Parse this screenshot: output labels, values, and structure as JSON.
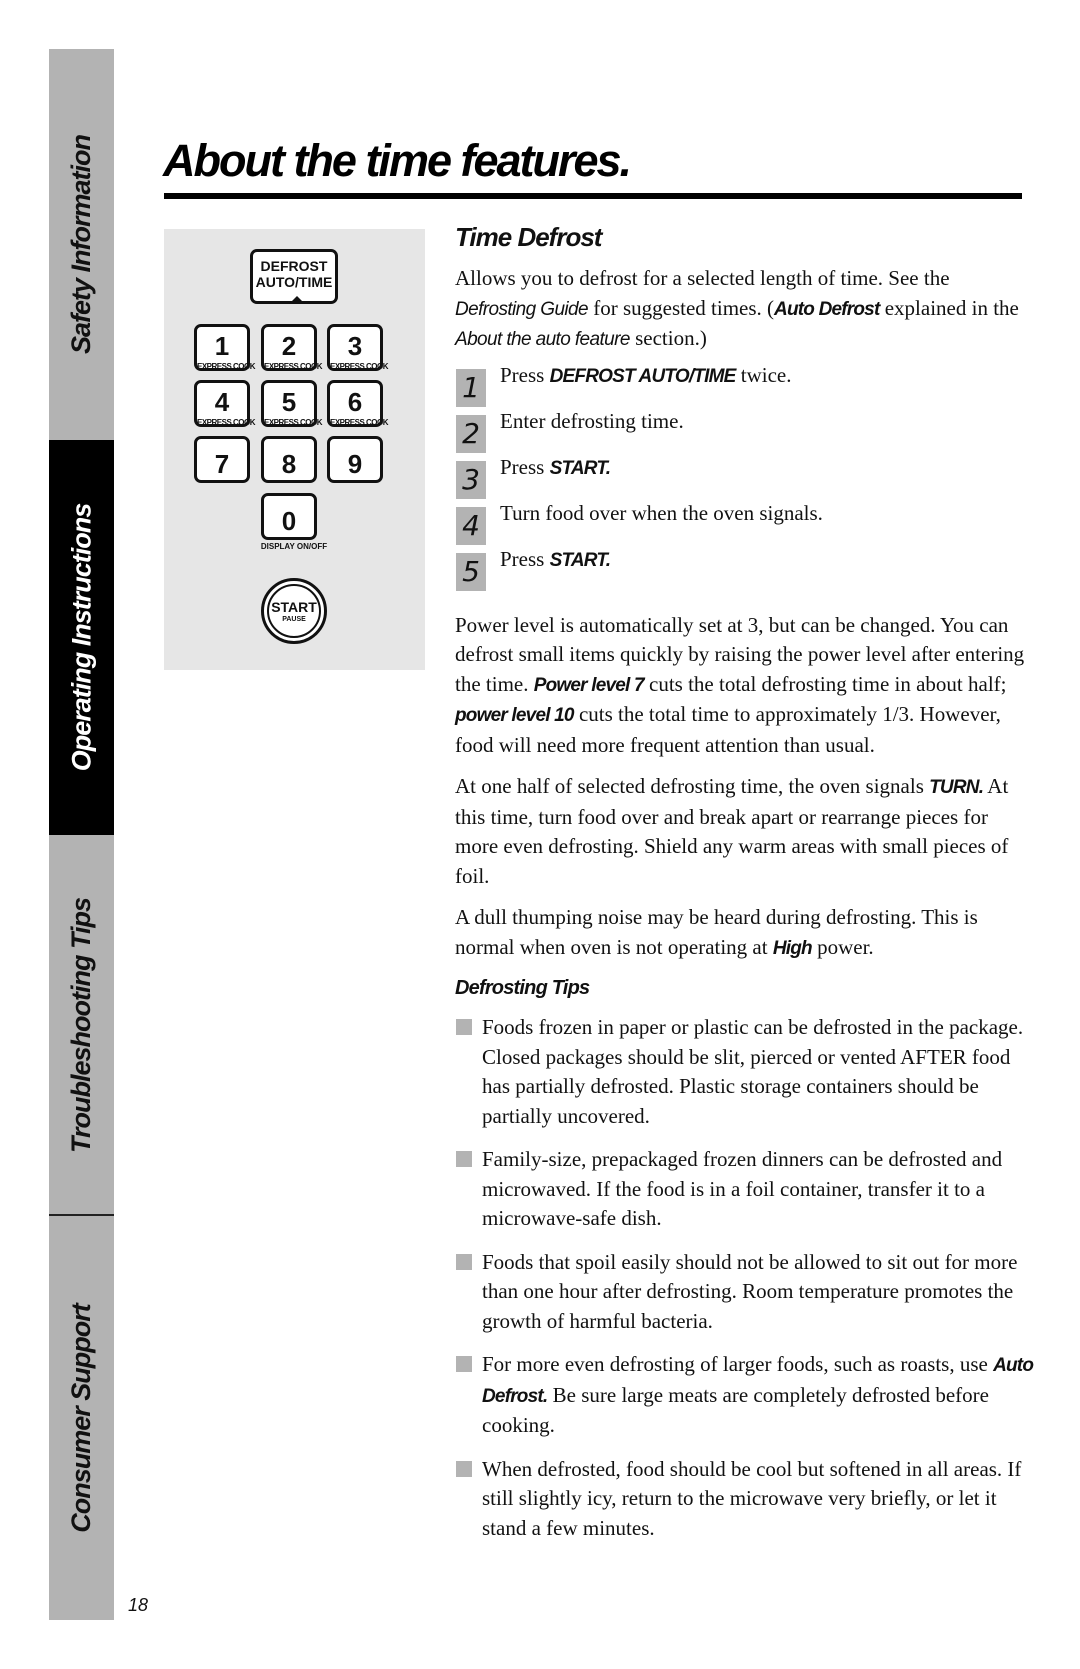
{
  "sidebar": {
    "tabs": [
      {
        "label": "Safety Information",
        "active": false
      },
      {
        "label": "Operating Instructions",
        "active": true
      },
      {
        "label": "Troubleshooting Tips",
        "active": false
      },
      {
        "label": "Consumer Support",
        "active": false
      }
    ]
  },
  "page": {
    "title": "About the time features.",
    "page_number": "18"
  },
  "keypad": {
    "defrost_line1": "DEFROST",
    "defrost_line2": "AUTO/TIME",
    "keys": [
      {
        "num": "1",
        "sub": "EXPRESS COOK"
      },
      {
        "num": "2",
        "sub": "EXPRESS COOK"
      },
      {
        "num": "3",
        "sub": "EXPRESS COOK"
      },
      {
        "num": "4",
        "sub": "EXPRESS COOK"
      },
      {
        "num": "5",
        "sub": "EXPRESS COOK"
      },
      {
        "num": "6",
        "sub": "EXPRESS COOK"
      },
      {
        "num": "7",
        "sub": ""
      },
      {
        "num": "8",
        "sub": ""
      },
      {
        "num": "9",
        "sub": ""
      },
      {
        "num": "0",
        "sub": ""
      }
    ],
    "display_label": "DISPLAY ON/OFF",
    "start_label": "START",
    "pause_label": "PAUSE"
  },
  "content": {
    "heading": "Time Defrost",
    "intro": {
      "t1": "Allows you to defrost for a selected length of time. See the ",
      "e1": "Defrosting Guide",
      "t2": " for suggested times. (",
      "s1": "Auto Defrost",
      "t3": " explained in the ",
      "e2": "About the auto feature",
      "t4": " section.)"
    },
    "steps": [
      {
        "n": "1",
        "pre": "Press ",
        "bold": "DEFROST AUTO/TIME",
        "post": " twice."
      },
      {
        "n": "2",
        "pre": "Enter defrosting time.",
        "bold": "",
        "post": ""
      },
      {
        "n": "3",
        "pre": "Press ",
        "bold": "START.",
        "post": ""
      },
      {
        "n": "4",
        "pre": "Turn food over when the oven signals.",
        "bold": "",
        "post": ""
      },
      {
        "n": "5",
        "pre": "Press ",
        "bold": "START.",
        "post": ""
      }
    ],
    "power": {
      "t1": "Power level is automatically set at 3, but can be changed. You can defrost small items quickly by raising the power level after entering the time. ",
      "s1": "Power level 7",
      "t2": "  cuts the total defrosting time in about half; ",
      "s2": "power level 10",
      "t3": "  cuts the total time to approximately 1/3. However, food will need more frequent attention than usual."
    },
    "half": {
      "t1": "At one half of selected defrosting time, the oven signals ",
      "s1": "TURN.",
      "t2": " At this time, turn food over and break apart or rearrange pieces for more even defrosting. Shield any warm areas with small pieces of foil."
    },
    "noise": {
      "t1": "A dull thumping noise may be heard during defrosting. This is normal when oven is not operating at ",
      "s1": "High",
      "t2": " power."
    },
    "tips_heading": "Defrosting Tips",
    "tips": [
      {
        "t1": "Foods frozen in paper or plastic can be defrosted in the package. Closed packages should be slit, pierced or vented AFTER food has partially defrosted. Plastic storage containers should be partially uncovered.",
        "s1": "",
        "t2": ""
      },
      {
        "t1": "Family-size, prepackaged frozen dinners can be defrosted and microwaved. If the food is in a foil container, transfer it to a microwave-safe dish.",
        "s1": "",
        "t2": ""
      },
      {
        "t1": "Foods that spoil easily should not be allowed to sit out for more than one hour after defrosting. Room temperature promotes the growth of harmful bacteria.",
        "s1": "",
        "t2": ""
      },
      {
        "t1": "For more even defrosting of larger foods, such as roasts, use ",
        "s1": "Auto Defrost.",
        "t2": " Be sure large meats are completely defrosted before cooking."
      },
      {
        "t1": "When defrosted, food should be cool but softened in all areas. If still slightly icy, return to the microwave very briefly, or let it stand a few minutes.",
        "s1": "",
        "t2": ""
      }
    ]
  }
}
